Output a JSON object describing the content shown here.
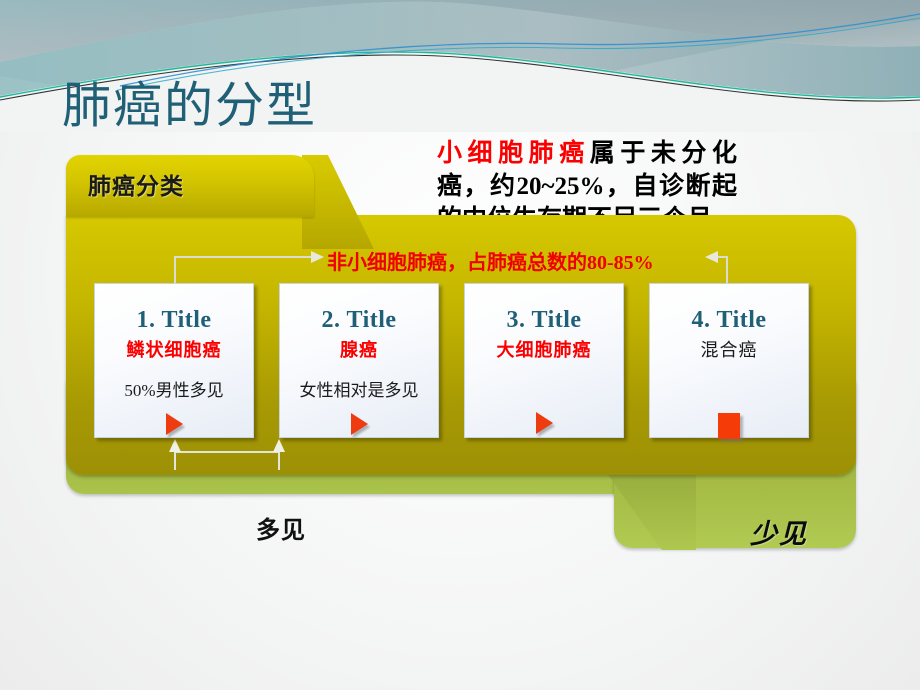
{
  "slide": {
    "title": "肺癌的分型",
    "title_color": "#1f6077"
  },
  "note": {
    "highlight": "小细胞肺癌",
    "highlight_color": "#fa0000",
    "rest": "属于未分化癌，约20~25%，自诊断起的中位生存期不足三个月"
  },
  "yellow_panel": {
    "tab_label": "肺癌分类",
    "arrow_note": "非小细胞肺癌，占肺癌总数的80-85%",
    "arrow_note_color": "#f00000",
    "fill_top": "#d6c800",
    "fill_bottom": "#9d9006"
  },
  "green_panel": {
    "label_left": "多见",
    "label_right": "少见",
    "fill_top": "#6e7532",
    "fill_bottom": "#b0ca52"
  },
  "cards": [
    {
      "title": "1. Title",
      "subtitle": "鳞状细胞癌",
      "subtitle_color": "#fa0000",
      "body": "50%男性多见",
      "icon": "play-triangle-icon"
    },
    {
      "title": "2. Title",
      "subtitle": "腺癌",
      "subtitle_color": "#fa0000",
      "body": "女性相对是多见",
      "icon": "play-triangle-icon"
    },
    {
      "title": "3. Title",
      "subtitle": "大细胞肺癌",
      "subtitle_color": "#fa0000",
      "body": "",
      "icon": "play-triangle-icon"
    },
    {
      "title": "4. Title",
      "subtitle": "混合癌",
      "subtitle_color": "#1b1b1b",
      "body": "",
      "icon": "square-icon"
    }
  ]
}
